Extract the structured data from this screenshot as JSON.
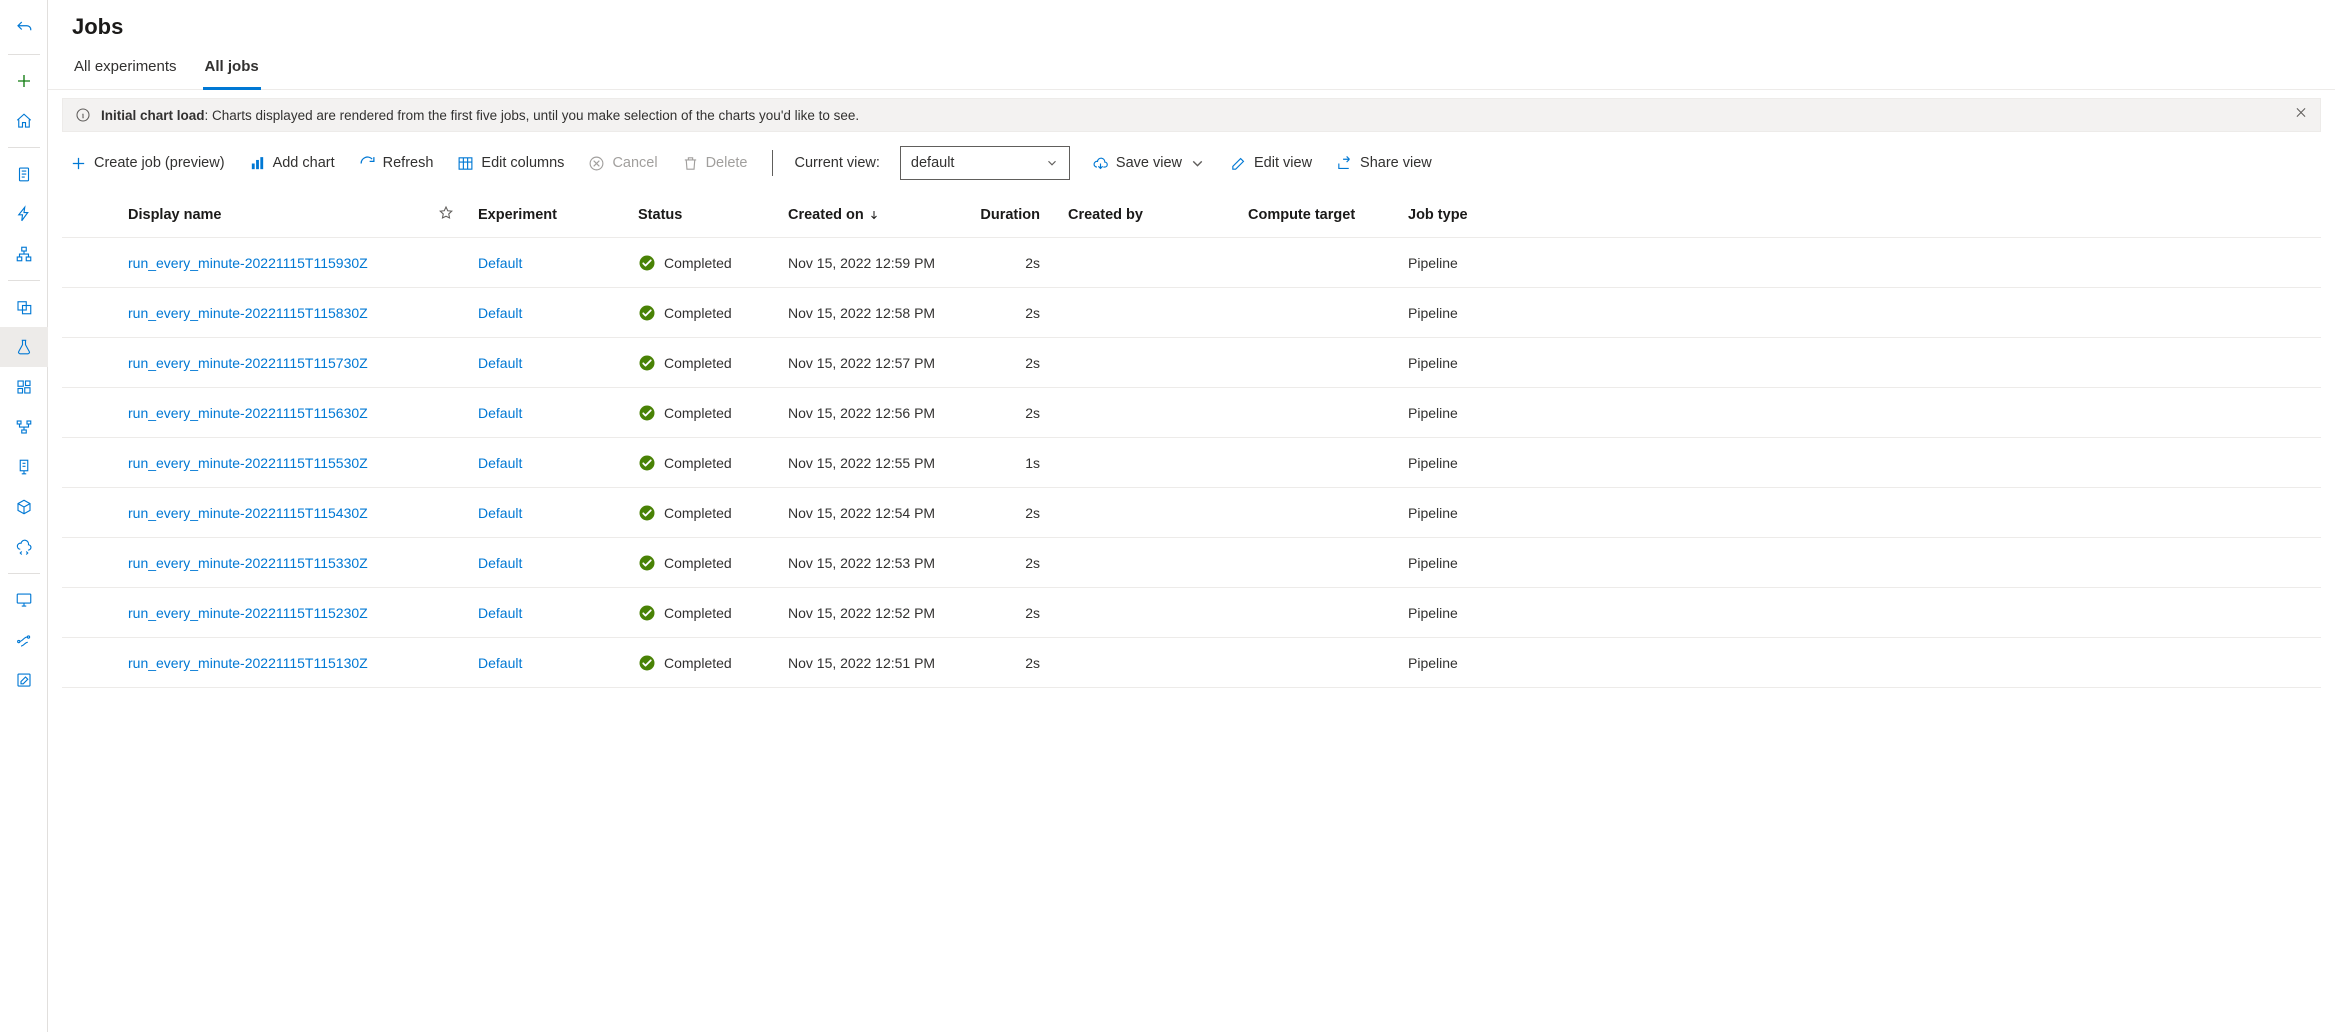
{
  "page": {
    "title": "Jobs"
  },
  "tabs": [
    {
      "id": "all-experiments",
      "label": "All experiments",
      "active": false
    },
    {
      "id": "all-jobs",
      "label": "All jobs",
      "active": true
    }
  ],
  "info_bar": {
    "bold": "Initial chart load",
    "text": ": Charts displayed are rendered from the first five jobs, until you make selection of the charts you'd like to see."
  },
  "commands": {
    "create_job": "Create job (preview)",
    "add_chart": "Add chart",
    "refresh": "Refresh",
    "edit_cols": "Edit columns",
    "cancel": "Cancel",
    "delete": "Delete",
    "current_view": "Current view:",
    "view_value": "default",
    "save_view": "Save view",
    "edit_view": "Edit view",
    "share_view": "Share view"
  },
  "columns": {
    "display_name": "Display name",
    "experiment": "Experiment",
    "status": "Status",
    "created_on": "Created on",
    "duration": "Duration",
    "created_by": "Created by",
    "compute_target": "Compute target",
    "job_type": "Job type"
  },
  "rows": [
    {
      "display_name": "run_every_minute-20221115T115930Z",
      "experiment": "Default",
      "status": "Completed",
      "created_on": "Nov 15, 2022 12:59 PM",
      "duration": "2s",
      "created_by": "",
      "compute_target": "",
      "job_type": "Pipeline"
    },
    {
      "display_name": "run_every_minute-20221115T115830Z",
      "experiment": "Default",
      "status": "Completed",
      "created_on": "Nov 15, 2022 12:58 PM",
      "duration": "2s",
      "created_by": "",
      "compute_target": "",
      "job_type": "Pipeline"
    },
    {
      "display_name": "run_every_minute-20221115T115730Z",
      "experiment": "Default",
      "status": "Completed",
      "created_on": "Nov 15, 2022 12:57 PM",
      "duration": "2s",
      "created_by": "",
      "compute_target": "",
      "job_type": "Pipeline"
    },
    {
      "display_name": "run_every_minute-20221115T115630Z",
      "experiment": "Default",
      "status": "Completed",
      "created_on": "Nov 15, 2022 12:56 PM",
      "duration": "2s",
      "created_by": "",
      "compute_target": "",
      "job_type": "Pipeline"
    },
    {
      "display_name": "run_every_minute-20221115T115530Z",
      "experiment": "Default",
      "status": "Completed",
      "created_on": "Nov 15, 2022 12:55 PM",
      "duration": "1s",
      "created_by": "",
      "compute_target": "",
      "job_type": "Pipeline"
    },
    {
      "display_name": "run_every_minute-20221115T115430Z",
      "experiment": "Default",
      "status": "Completed",
      "created_on": "Nov 15, 2022 12:54 PM",
      "duration": "2s",
      "created_by": "",
      "compute_target": "",
      "job_type": "Pipeline"
    },
    {
      "display_name": "run_every_minute-20221115T115330Z",
      "experiment": "Default",
      "status": "Completed",
      "created_on": "Nov 15, 2022 12:53 PM",
      "duration": "2s",
      "created_by": "",
      "compute_target": "",
      "job_type": "Pipeline"
    },
    {
      "display_name": "run_every_minute-20221115T115230Z",
      "experiment": "Default",
      "status": "Completed",
      "created_on": "Nov 15, 2022 12:52 PM",
      "duration": "2s",
      "created_by": "",
      "compute_target": "",
      "job_type": "Pipeline"
    },
    {
      "display_name": "run_every_minute-20221115T115130Z",
      "experiment": "Default",
      "status": "Completed",
      "created_on": "Nov 15, 2022 12:51 PM",
      "duration": "2s",
      "created_by": "",
      "compute_target": "",
      "job_type": "Pipeline"
    }
  ]
}
